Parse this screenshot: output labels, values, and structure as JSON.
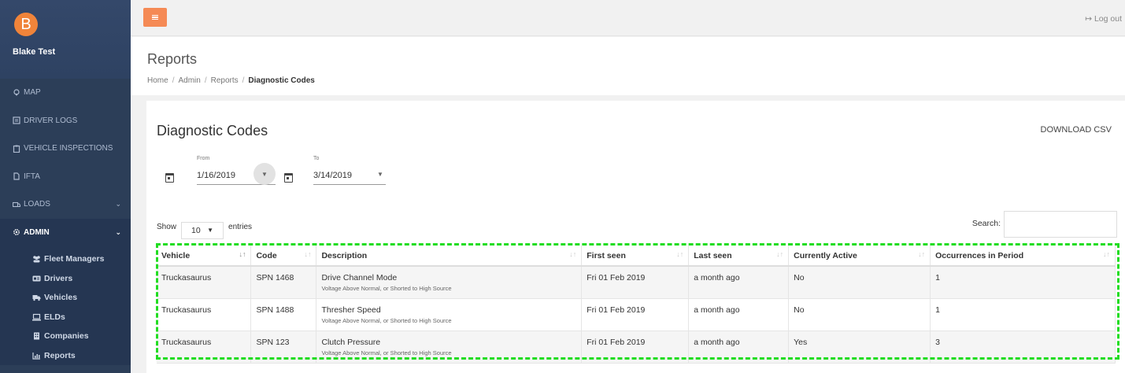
{
  "user": {
    "initial": "B",
    "name": "Blake Test"
  },
  "nav": {
    "items": [
      {
        "label": "MAP",
        "icon": "map-pin-icon"
      },
      {
        "label": "DRIVER LOGS",
        "icon": "log-icon"
      },
      {
        "label": "VEHICLE INSPECTIONS",
        "icon": "clipboard-icon"
      },
      {
        "label": "IFTA",
        "icon": "document-icon"
      },
      {
        "label": "LOADS",
        "icon": "truck-icon"
      },
      {
        "label": "ADMIN",
        "icon": "gear-icon"
      }
    ],
    "admin_sub": [
      {
        "label": "Fleet Managers",
        "icon": "users-icon"
      },
      {
        "label": "Drivers",
        "icon": "id-card-icon"
      },
      {
        "label": "Vehicles",
        "icon": "truck-icon"
      },
      {
        "label": "ELDs",
        "icon": "laptop-icon"
      },
      {
        "label": "Companies",
        "icon": "building-icon"
      },
      {
        "label": "Reports",
        "icon": "chart-icon"
      }
    ]
  },
  "topbar": {
    "logout_label": "Log out"
  },
  "header": {
    "title": "Reports",
    "breadcrumb": [
      "Home",
      "Admin",
      "Reports",
      "Diagnostic Codes"
    ]
  },
  "panel": {
    "title": "Diagnostic Codes",
    "download_label": "DOWNLOAD CSV",
    "from_label": "From",
    "from_value": "1/16/2019",
    "to_label": "To",
    "to_value": "3/14/2019",
    "show_label": "Show",
    "entries_value": "10",
    "entries_label": "entries",
    "search_label": "Search:"
  },
  "table": {
    "columns": [
      "Vehicle",
      "Code",
      "Description",
      "First seen",
      "Last seen",
      "Currently Active",
      "Occurrences in Period"
    ],
    "rows": [
      {
        "vehicle": "Truckasaurus",
        "code": "SPN 1468",
        "desc": "Drive Channel Mode",
        "sub": "Voltage Above Normal, or Shorted to High Source",
        "first": "Fri 01 Feb 2019",
        "last": "a month ago",
        "active": "No",
        "occ": "1"
      },
      {
        "vehicle": "Truckasaurus",
        "code": "SPN 1488",
        "desc": "Thresher Speed",
        "sub": "Voltage Above Normal, or Shorted to High Source",
        "first": "Fri 01 Feb 2019",
        "last": "a month ago",
        "active": "No",
        "occ": "1"
      },
      {
        "vehicle": "Truckasaurus",
        "code": "SPN 123",
        "desc": "Clutch Pressure",
        "sub": "Voltage Above Normal, or Shorted to High Source",
        "first": "Fri 01 Feb 2019",
        "last": "a month ago",
        "active": "Yes",
        "occ": "3"
      }
    ]
  },
  "colors": {
    "sidebar": "#2c3e58",
    "accent": "#f58a55",
    "avatar": "#f0843a",
    "highlight": "#22dd22"
  }
}
